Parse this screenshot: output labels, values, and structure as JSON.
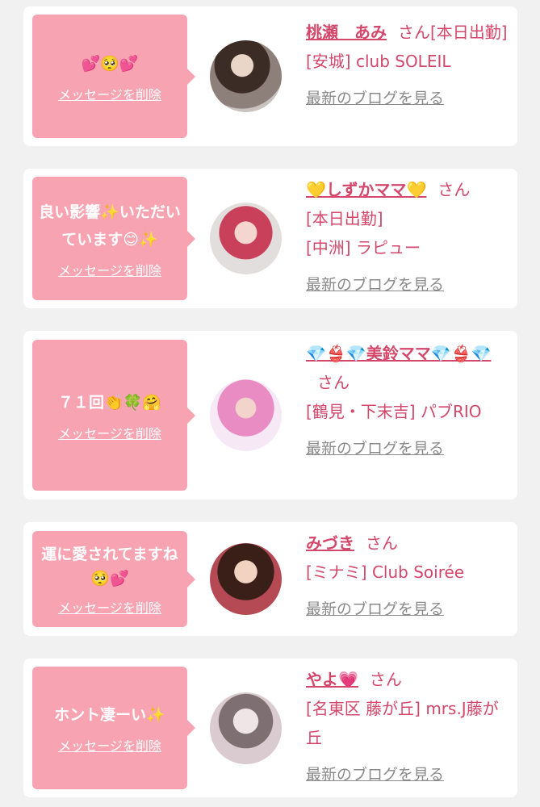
{
  "delete_label": "メッセージを削除",
  "blog_label": "最新のブログを見る",
  "san_label": "さん",
  "items": [
    {
      "message": "💕🥺💕",
      "name": "桃瀬　あみ",
      "status": "[本日出勤]",
      "shop": "[安城] club SOLEIL"
    },
    {
      "message": "良い影響✨いただいています😊✨",
      "name": "💛しずかママ💛",
      "status": "[本日出勤]",
      "shop": "[中洲] ラピュー"
    },
    {
      "message": "７１回👏🍀🤗",
      "name": "💎👙💎美鈴ママ💎👙💎",
      "status": "",
      "shop": "[鶴見・下末吉] パブRIO"
    },
    {
      "message": "運に愛されてますね🥺💕",
      "name": "みづき",
      "status": "",
      "shop": "[ミナミ] Club Soirée"
    },
    {
      "message": "ホント凄ーい✨",
      "name": "やよ💗",
      "status": "",
      "shop": "[名東区 藤が丘] mrs.J藤が丘"
    }
  ]
}
